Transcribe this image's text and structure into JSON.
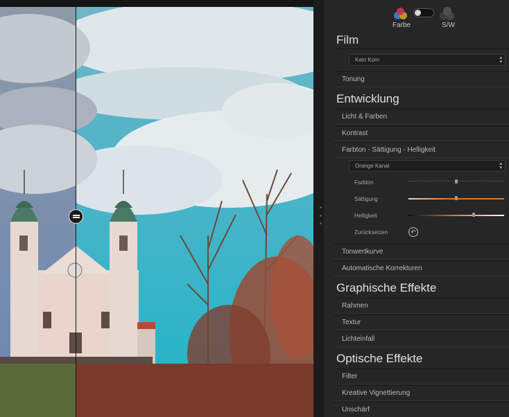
{
  "mode": {
    "color_label": "Farbe",
    "bw_label": "S/W",
    "toggle_on": false
  },
  "sections": {
    "film": {
      "title": "Film",
      "grain_select": "Kein Korn",
      "toning": "Tonung"
    },
    "entwicklung": {
      "title": "Entwicklung",
      "items": [
        "Licht & Farben",
        "Kontrast",
        "Farbton - Sättigung - Helligkeit"
      ],
      "channel_select": "Orange Kanal",
      "sliders": [
        {
          "label": "Farbton",
          "value": 0.5
        },
        {
          "label": "Sättigung",
          "value": 0.5
        },
        {
          "label": "Helligkeit",
          "value": 0.69
        }
      ],
      "reset_label": "Zurücksetzen",
      "items_after": [
        "Tonwertkurve",
        "Automatische Korrekturen"
      ]
    },
    "graphische": {
      "title": "Graphische Effekte",
      "items": [
        "Rahmen",
        "Textur",
        "Lichteinfall"
      ]
    },
    "optische": {
      "title": "Optische Effekte",
      "items": [
        "Filter",
        "Kreative Vignettierung",
        "Unschärf"
      ]
    }
  },
  "colors": {
    "accent": "#e07a2e",
    "panel": "#262626"
  }
}
